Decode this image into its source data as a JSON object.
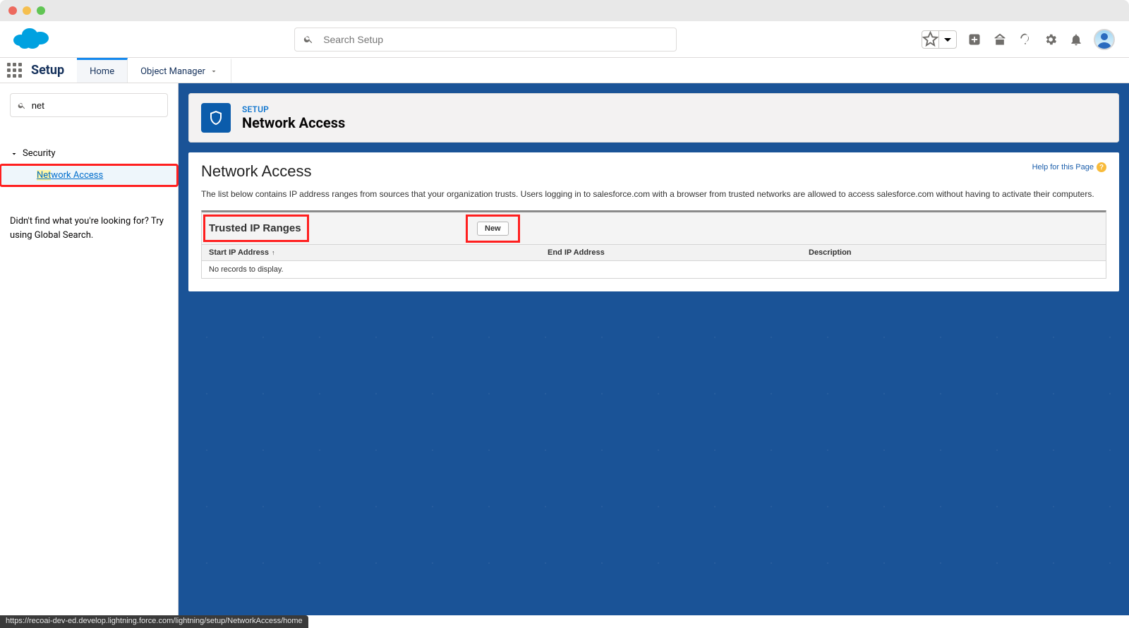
{
  "chrome": {},
  "header": {
    "search_placeholder": "Search Setup"
  },
  "context": {
    "app_name": "Setup",
    "tabs": [
      {
        "label": "Home",
        "active": true
      },
      {
        "label": "Object Manager",
        "active": false
      }
    ]
  },
  "sidebar": {
    "search_value": "net",
    "section": {
      "label": "Security"
    },
    "item": {
      "prefix": "Net",
      "rest": "work Access"
    },
    "hint": "Didn't find what you're looking for? Try using Global Search."
  },
  "page": {
    "kicker": "SETUP",
    "title": "Network Access"
  },
  "content": {
    "title": "Network Access",
    "description": "The list below contains IP address ranges from sources that your organization trusts. Users logging in to salesforce.com with a browser from trusted networks are allowed to access salesforce.com without having to activate their computers.",
    "help_label": "Help for this Page",
    "list": {
      "title": "Trusted IP Ranges",
      "new_button": "New",
      "columns": {
        "start": "Start IP Address",
        "end": "End IP Address",
        "desc": "Description"
      },
      "empty_message": "No records to display."
    }
  },
  "status_bar": "https://recoai-dev-ed.develop.lightning.force.com/lightning/setup/NetworkAccess/home"
}
